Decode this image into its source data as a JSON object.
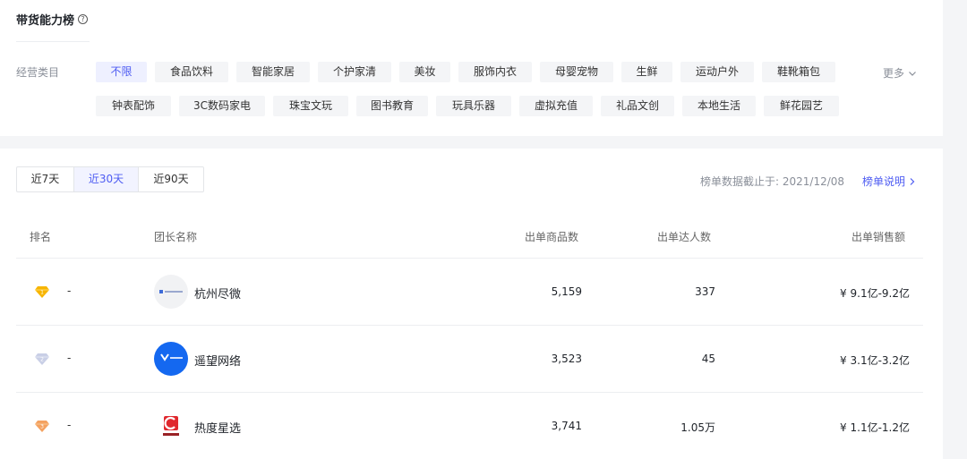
{
  "header": {
    "title": "带货能力榜",
    "help_icon": "question-circle-icon"
  },
  "category": {
    "label": "经营类目",
    "more_label": "更多",
    "items": [
      "不限",
      "食品饮料",
      "智能家居",
      "个护家清",
      "美妆",
      "服饰内衣",
      "母婴宠物",
      "生鲜",
      "运动户外",
      "鞋靴箱包",
      "钟表配饰",
      "3C数码家电",
      "珠宝文玩",
      "图书教育",
      "玩具乐器",
      "虚拟充值",
      "礼品文创",
      "本地生活",
      "鲜花园艺"
    ],
    "selected": "不限"
  },
  "time_range": {
    "options": [
      "近7天",
      "近30天",
      "近90天"
    ],
    "selected": "近30天"
  },
  "cutoff_text": "榜单数据截止于: 2021/12/08",
  "explain_label": "榜单说明",
  "table": {
    "headers": {
      "rank": "排名",
      "name": "团长名称",
      "products": "出单商品数",
      "creators": "出单达人数",
      "sales": "出单销售额"
    },
    "rows": [
      {
        "rank": "1",
        "change": "-",
        "name": "杭州尽微",
        "products": "5,159",
        "creators": "337",
        "sales": "¥ 9.1亿-9.2亿"
      },
      {
        "rank": "2",
        "change": "-",
        "name": "遥望网络",
        "products": "3,523",
        "creators": "45",
        "sales": "¥ 3.1亿-3.2亿"
      },
      {
        "rank": "3",
        "change": "-",
        "name": "热度星选",
        "products": "3,741",
        "creators": "1.05万",
        "sales": "¥ 1.1亿-1.2亿"
      }
    ]
  },
  "colors": {
    "accent": "#4e5cf2",
    "gold": "#f7b500",
    "silver": "#c9cfe6",
    "bronze": "#f4a261",
    "logo_blue": "#1468f0",
    "logo_red": "#e0282e"
  }
}
